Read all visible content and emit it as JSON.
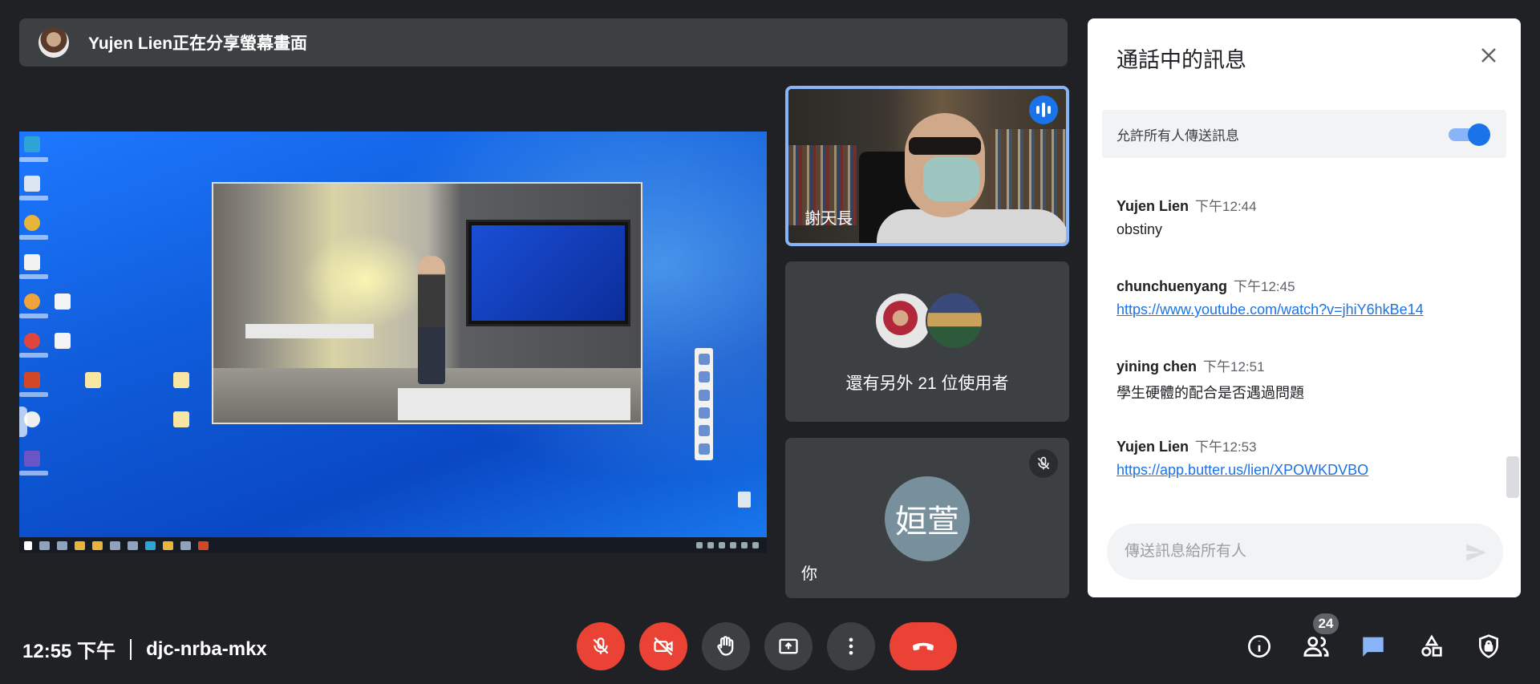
{
  "banner": {
    "presenter_text": "Yujen Lien正在分享螢幕畫面"
  },
  "tiles": {
    "speaker_name": "謝天長",
    "others_label": "還有另外 21 位使用者",
    "you_initials": "姮萱",
    "you_label": "你"
  },
  "chat": {
    "title": "通話中的訊息",
    "allow_label": "允許所有人傳送訊息",
    "allow_enabled": true,
    "messages": [
      {
        "sender": "Yujen Lien",
        "time": "下午12:44",
        "text": "obstiny",
        "is_link": false
      },
      {
        "sender": "chunchuenyang",
        "time": "下午12:45",
        "text": "https://www.youtube.com/watch?v=jhiY6hkBe14",
        "is_link": true
      },
      {
        "sender": "yining chen",
        "time": "下午12:51",
        "text": "學生硬體的配合是否遇過問題",
        "is_link": false
      },
      {
        "sender": "Yujen Lien",
        "time": "下午12:53",
        "text": "https://app.butter.us/lien/XPOWKDVBO",
        "is_link": true
      }
    ],
    "input_placeholder": "傳送訊息給所有人"
  },
  "bottom": {
    "time": "12:55 下午",
    "meeting_code": "djc-nrba-mkx",
    "people_count": "24"
  },
  "colors": {
    "accent_blue": "#1a73e8",
    "danger_red": "#ea4335",
    "tile_bg": "#3c4043",
    "page_bg": "#202124"
  },
  "icons": {
    "close": "close-icon",
    "mic_off": "mic-off-icon",
    "cam_off": "camera-off-icon",
    "raise_hand": "hand-icon",
    "present": "present-screen-icon",
    "more": "more-vert-icon",
    "hang_up": "phone-hangup-icon",
    "info": "info-icon",
    "people": "people-icon",
    "chat": "chat-icon",
    "activities": "activities-icon",
    "host_controls": "shield-lock-icon",
    "send": "send-icon",
    "audio": "audio-indicator-icon"
  }
}
